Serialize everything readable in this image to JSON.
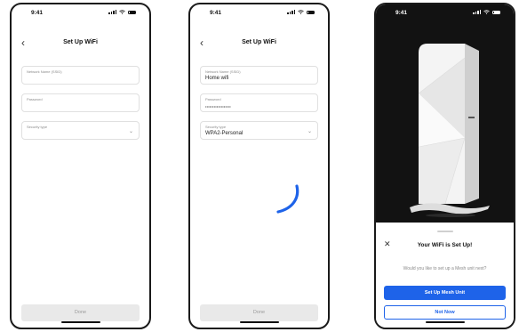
{
  "status": {
    "time": "9:41"
  },
  "screen1": {
    "title": "Set Up WiFi",
    "fields": {
      "ssid_label": "Network Name (SSID)",
      "password_label": "Password",
      "security_label": "Security type"
    },
    "done_label": "Done"
  },
  "screen2": {
    "title": "Set Up WiFi",
    "fields": {
      "ssid_label": "Network Name (SSID)",
      "ssid_value": "Home wifi",
      "password_label": "Password",
      "password_value": "••••••••••••••••••",
      "security_label": "Security type",
      "security_value": "WPA2-Personal"
    },
    "done_label": "Done"
  },
  "screen3": {
    "sheet_title": "Your WiFi is Set Up!",
    "sheet_subtitle": "Would you like to set up a Mesh unit next?",
    "primary_label": "Set Up Mesh Unit",
    "secondary_label": "Not Now"
  },
  "icons": {
    "back": "chevron-left-icon",
    "chevron": "chevron-down-icon",
    "close": "close-icon",
    "spinner": "loading-spinner-icon"
  },
  "colors": {
    "accent": "#1e63e9",
    "disabled_button": "#e9e9e9",
    "photo_background": "#121212"
  }
}
